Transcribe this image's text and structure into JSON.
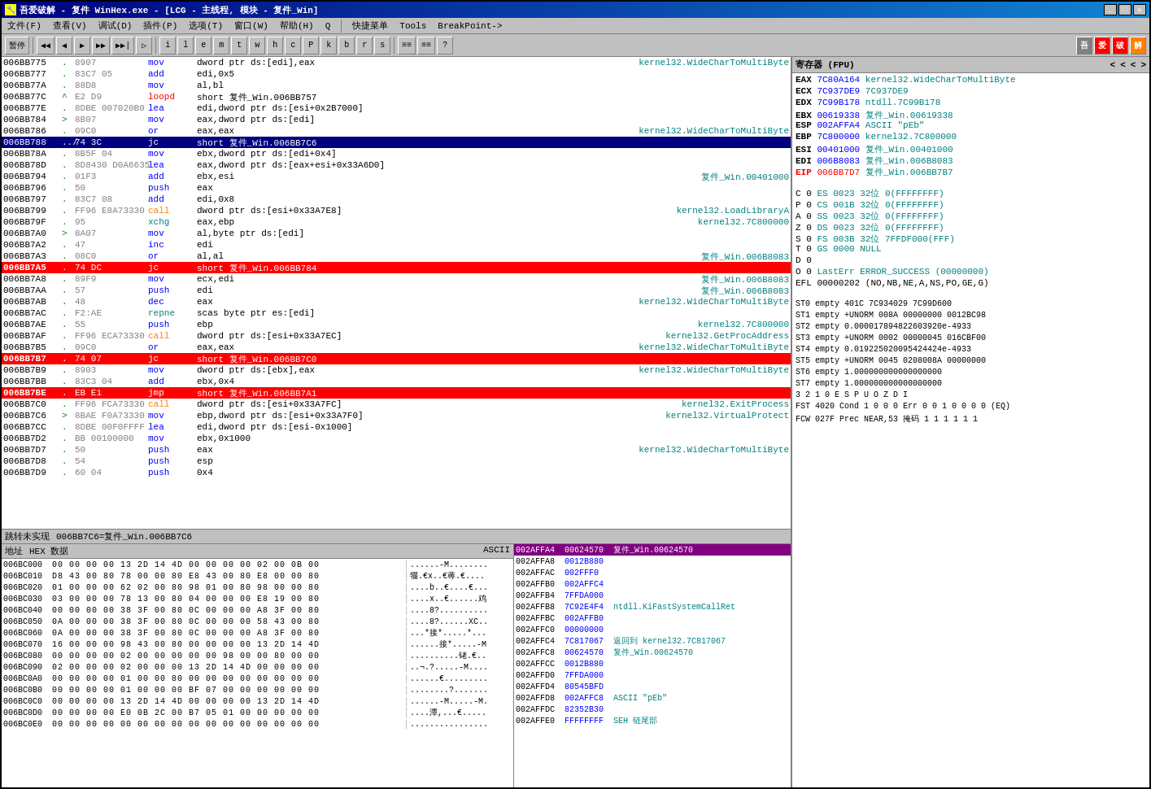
{
  "window": {
    "title": "吾爱破解 - 复件 WinHex.exe - [LCG - 主线程, 模块 - 复件_Win]",
    "titlebar_icon": "🔧"
  },
  "menu": {
    "items": [
      "文件(F)",
      "查看(V)",
      "调试(D)",
      "插件(P)",
      "选项(T)",
      "窗口(W)",
      "帮助(H)",
      "Q",
      "快捷菜单",
      "Tools",
      "BreakPoint->"
    ]
  },
  "toolbar": {
    "buttons": [
      "暂停",
      "◀◀",
      "◀",
      "▶▶",
      "▶▶|",
      "▶▶▶",
      "▷",
      "i",
      "l",
      "e",
      "m",
      "t",
      "w",
      "h",
      "c",
      "P",
      "k",
      "b",
      "r",
      "s",
      "≡≡",
      "≡≡",
      "?"
    ],
    "right_buttons": [
      "吾",
      "爱",
      "破",
      "解"
    ]
  },
  "disasm": {
    "rows": [
      {
        "addr": "006BB775",
        "arrow": ".",
        "bytes": "8907",
        "mnemonic": "mov",
        "operands": "dword ptr ds:[edi],eax",
        "comment": "kernel32.WideCharToMultiByte",
        "style": "normal"
      },
      {
        "addr": "006BB777",
        "arrow": ".",
        "bytes": "83C7 05",
        "mnemonic": "add",
        "operands": "edi,0x5",
        "comment": "",
        "style": "normal"
      },
      {
        "addr": "006BB77A",
        "arrow": ".",
        "bytes": "88D8",
        "mnemonic": "mov",
        "operands": "al,bl",
        "comment": "",
        "style": "normal"
      },
      {
        "addr": "006BB77C",
        "arrow": "^",
        "bytes": "E2 D9",
        "mnemonic": "loopd",
        "operands": "short 复件_Win.006BB757",
        "comment": "",
        "style": "normal"
      },
      {
        "addr": "006BB77E",
        "arrow": ".",
        "bytes": "8DBE 007020B0",
        "mnemonic": "lea",
        "operands": "edi,dword ptr ds:[esi+0x2B7000]",
        "comment": "",
        "style": "normal"
      },
      {
        "addr": "006BB784",
        "arrow": ">",
        "bytes": "8B07",
        "mnemonic": "mov",
        "operands": "eax,dword ptr ds:[edi]",
        "comment": "",
        "style": "normal"
      },
      {
        "addr": "006BB786",
        "arrow": ".",
        "bytes": "09C0",
        "mnemonic": "or",
        "operands": "eax,eax",
        "comment": "kernel32.WideCharToMultiByte",
        "style": "normal"
      },
      {
        "addr": "006BB788",
        "arrow": "../",
        "bytes": "74 3C",
        "mnemonic": "jc",
        "operands": "short 复件_Win.006BB7C6",
        "comment": "",
        "style": "selected"
      },
      {
        "addr": "006BB78A",
        "arrow": ".",
        "bytes": "8B5F 04",
        "mnemonic": "mov",
        "operands": "ebx,dword ptr ds:[edi+0x4]",
        "comment": "",
        "style": "normal"
      },
      {
        "addr": "006BB78D",
        "arrow": ".",
        "bytes": "8D8430 D0A6635",
        "mnemonic": "lea",
        "operands": "eax,dword ptr ds:[eax+esi+0x33A6D0]",
        "comment": "",
        "style": "normal"
      },
      {
        "addr": "006BB794",
        "arrow": ".",
        "bytes": "01F3",
        "mnemonic": "add",
        "operands": "ebx,esi",
        "comment": "复件_Win.00401000",
        "style": "normal"
      },
      {
        "addr": "006BB796",
        "arrow": ".",
        "bytes": "50",
        "mnemonic": "push",
        "operands": "eax",
        "comment": "",
        "style": "normal"
      },
      {
        "addr": "006BB797",
        "arrow": ".",
        "bytes": "83C7 08",
        "mnemonic": "add",
        "operands": "edi,0x8",
        "comment": "",
        "style": "normal"
      },
      {
        "addr": "006BB799",
        "arrow": ".",
        "bytes": "FF96 E8A73330",
        "mnemonic": "call",
        "operands": "dword ptr ds:[esi+0x33A7E8]",
        "comment": "kernel32.LoadLibraryA",
        "style": "normal"
      },
      {
        "addr": "006BB79F",
        "arrow": ".",
        "bytes": "95",
        "mnemonic": "xchg",
        "operands": "eax,ebp",
        "comment": "kernel32.7C800000",
        "style": "normal"
      },
      {
        "addr": "006BB7A0",
        "arrow": ">",
        "bytes": "8A07",
        "mnemonic": "mov",
        "operands": "al,byte ptr ds:[edi]",
        "comment": "",
        "style": "normal"
      },
      {
        "addr": "006BB7A2",
        "arrow": ".",
        "bytes": "47",
        "mnemonic": "inc",
        "operands": "edi",
        "comment": "",
        "style": "normal"
      },
      {
        "addr": "006BB7A3",
        "arrow": ".",
        "bytes": "08C0",
        "mnemonic": "or",
        "operands": "al,al",
        "comment": "复件_Win.006B8083",
        "style": "normal"
      },
      {
        "addr": "006BB7A5",
        "arrow": ".",
        "bytes": "74 DC",
        "mnemonic": "jc",
        "operands": "short 复件_Win.006BB784",
        "comment": "",
        "style": "red"
      },
      {
        "addr": "006BB7A8",
        "arrow": ".",
        "bytes": "89F9",
        "mnemonic": "mov",
        "operands": "ecx,edi",
        "comment": "复件_Win.006B8083",
        "style": "normal"
      },
      {
        "addr": "006BB7AA",
        "arrow": ".",
        "bytes": "57",
        "mnemonic": "push",
        "operands": "edi",
        "comment": "复件_Win.006B8083",
        "style": "normal"
      },
      {
        "addr": "006BB7AB",
        "arrow": ".",
        "bytes": "48",
        "mnemonic": "dec",
        "operands": "eax",
        "comment": "kernel32.WideCharToMultiByte",
        "style": "normal"
      },
      {
        "addr": "006BB7AC",
        "arrow": ".",
        "bytes": "F2:AE",
        "mnemonic": "repne",
        "operands": "scas byte ptr es:[edi]",
        "comment": "",
        "style": "normal"
      },
      {
        "addr": "006BB7AE",
        "arrow": ".",
        "bytes": "55",
        "mnemonic": "push",
        "operands": "ebp",
        "comment": "kernel32.7C800000",
        "style": "normal"
      },
      {
        "addr": "006BB7AF",
        "arrow": ".",
        "bytes": "FF96 ECA73330",
        "mnemonic": "call",
        "operands": "dword ptr ds:[esi+0x33A7EC]",
        "comment": "kernel32.GetProcAddress",
        "style": "normal"
      },
      {
        "addr": "006BB7B5",
        "arrow": ".",
        "bytes": "09C0",
        "mnemonic": "or",
        "operands": "eax,eax",
        "comment": "kernel32.WideCharToMultiByte",
        "style": "normal"
      },
      {
        "addr": "006BB7B7",
        "arrow": ".",
        "bytes": "74 07",
        "mnemonic": "jc",
        "operands": "short 复件_Win.006BB7C0",
        "comment": "",
        "style": "red"
      },
      {
        "addr": "006BB7B9",
        "arrow": ".",
        "bytes": "8903",
        "mnemonic": "mov",
        "operands": "dword ptr ds:[ebx],eax",
        "comment": "kernel32.WideCharToMultiByte",
        "style": "normal"
      },
      {
        "addr": "006BB7BB",
        "arrow": ".",
        "bytes": "83C3 04",
        "mnemonic": "add",
        "operands": "ebx,0x4",
        "comment": "",
        "style": "normal"
      },
      {
        "addr": "006BB7BE",
        "arrow": ".",
        "bytes": "EB E1",
        "mnemonic": "jmp",
        "operands": "short 复件_Win.006BB7A1",
        "comment": "",
        "style": "red"
      },
      {
        "addr": "006BB7C0",
        "arrow": ".",
        "bytes": "FF96 FCA73330",
        "mnemonic": "call",
        "operands": "dword ptr ds:[esi+0x33A7FC]",
        "comment": "kernel32.ExitProcess",
        "style": "normal"
      },
      {
        "addr": "006BB7C6",
        "arrow": ">",
        "bytes": "8BAE F0A73330",
        "mnemonic": "mov",
        "operands": "ebp,dword ptr ds:[esi+0x33A7F0]",
        "comment": "kernel32.VirtualProtect",
        "style": "normal"
      },
      {
        "addr": "006BB7CC",
        "arrow": ".",
        "bytes": "8DBE 00F0FFFF",
        "mnemonic": "lea",
        "operands": "edi,dword ptr ds:[esi-0x1000]",
        "comment": "",
        "style": "normal"
      },
      {
        "addr": "006BB7D2",
        "arrow": ".",
        "bytes": "BB 00100000",
        "mnemonic": "mov",
        "operands": "ebx,0x1000",
        "comment": "",
        "style": "normal"
      },
      {
        "addr": "006BB7D7",
        "arrow": ".",
        "bytes": "50",
        "mnemonic": "push",
        "operands": "eax",
        "comment": "kernel32.WideCharToMultiByte",
        "style": "normal"
      },
      {
        "addr": "006BB7D8",
        "arrow": ".",
        "bytes": "54",
        "mnemonic": "push",
        "operands": "esp",
        "comment": "",
        "style": "normal"
      },
      {
        "addr": "006BB7D9",
        "arrow": ".",
        "bytes": "60 04",
        "mnemonic": "push",
        "operands": "0x4",
        "comment": "",
        "style": "normal"
      }
    ]
  },
  "status": {
    "text1": "跳转未实现",
    "text2": "006BB7C6=复件_Win.006BB7C6"
  },
  "registers": {
    "title": "寄存器 (FPU)",
    "rows": [
      {
        "name": "EAX",
        "val": "7C80A164",
        "comment": "kernel32.WideCharToMultiByte"
      },
      {
        "name": "ECX",
        "val": "7C937DE9",
        "comment": "7C937DE9"
      },
      {
        "name": "EDX",
        "val": "7C99B178",
        "comment": "ntdll.7C99B178"
      },
      {
        "name": "EBX",
        "val": "00619338",
        "comment": "复件_Win.00619338"
      },
      {
        "name": "ESP",
        "val": "002AFFA4",
        "comment": "ASCII \"pEb\""
      },
      {
        "name": "EBP",
        "val": "7C800000",
        "comment": "kernel32.7C800000"
      },
      {
        "name": "ESI",
        "val": "00401000",
        "comment": "复件_Win.00401000"
      },
      {
        "name": "EDI",
        "val": "006B8083",
        "comment": "复件_Win.006B8083"
      },
      {
        "name": "EIP",
        "val": "006BB7D7",
        "comment": "复件_Win.006BB7B7",
        "style": "eip"
      }
    ],
    "flags": [
      {
        "name": "C 0",
        "comment": "ES 0023  32位  0(FFFFFFFF)"
      },
      {
        "name": "P 0",
        "comment": "CS 001B  32位  0(FFFFFFFF)"
      },
      {
        "name": "A 0",
        "comment": "SS 0023  32位  0(FFFFFFFF)"
      },
      {
        "name": "Z 0",
        "comment": "DS 0023  32位  0(FFFFFFFF)"
      },
      {
        "name": "S 0",
        "comment": "FS 003B  32位  7FFDF000(FFF)"
      },
      {
        "name": "T 0",
        "comment": "GS 0000  NULL"
      },
      {
        "name": "D 0",
        "comment": ""
      },
      {
        "name": "O 0",
        "comment": "LastErr ERROR_SUCCESS (00000000)"
      }
    ],
    "efl": "EFL 00000202 (NO,NB,NE,A,NS,PO,GE,G)",
    "fpu_rows": [
      "ST0 empty  401C  7C934029  7C99D600",
      "ST1 empty +UNORM 008A  00000000  0012BC98",
      "ST2 empty  0.000017894822603920e-4933",
      "ST3 empty +UNORM 0002  00000045  016CBF00",
      "ST4 empty  0.019225020095424424e-4933",
      "ST5 empty +UNORM 0045  0208008A  00000000",
      "ST6 empty  1.000000000000000000",
      "ST7 empty  1.000000000000000000",
      "       3 2 1 0      E S P U O Z D I",
      "FST 4020  Cond 1 0 0 0  Err 0 0 1 0 0 0 0  (EQ)",
      "FCW 027F  Prec NEAR,53  掩码   1 1 1 1 1 1"
    ]
  },
  "hex": {
    "headers": [
      "地址",
      "HEX 数据",
      "ASCII"
    ],
    "rows": [
      {
        "addr": "006BC000",
        "hex": "00 00 00 00 13 2D 14 4D 00 00 00 00 02 00 0B 00",
        "ascii": "......-M........"
      },
      {
        "addr": "006BC010",
        "hex": "D8 43 00 80 78 00 00 80 E8 43 00 80 E8 00 00 80",
        "ascii": "犤.€x..€蒪.€...."
      },
      {
        "addr": "006BC020",
        "hex": "01 00 00 00 62 02 00 80 98 01 00 80 98 00 00 80",
        "ascii": "....b..€....€..."
      },
      {
        "addr": "006BC030",
        "hex": "03 00 00 00 78 13 00 80 04 00 00 00 E8 19 00 80",
        "ascii": "....x..€......鸡"
      },
      {
        "addr": "006BC040",
        "hex": "00 00 00 00 38 3F 00 80 0C 00 00 00 A8 3F 00 80",
        "ascii": "....8?.........."
      },
      {
        "addr": "006BC050",
        "hex": "0A 00 00 00 38 3F 00 80 0C 00 00 00 58 43 00 80",
        "ascii": "....8?......XC.."
      },
      {
        "addr": "006BC060",
        "hex": "0A 00 00 00 38 3F 00 80 0C 00 00 00 A8 3F 00 80",
        "ascii": "...*接*.....*..."
      },
      {
        "addr": "006BC070",
        "hex": "16 00 00 00 98 43 00 80 00 00 00 00 13 2D 14 4D",
        "ascii": "......接*.....-M"
      },
      {
        "addr": "006BC080",
        "hex": "00 00 00 00 02 00 00 00 00 00 98 00 00 80 00 00",
        "ascii": "..........铑.€.."
      },
      {
        "addr": "006BC090",
        "hex": "02 00 00 00 02 00 00 00 13 2D 14 4D 00 00 00 00",
        "ascii": "..¬.?.....-M...."
      },
      {
        "addr": "006BC0A0",
        "hex": "00 00 00 00 01 00 00 80 00 00 00 00 00 00 00 00",
        "ascii": "......€........."
      },
      {
        "addr": "006BC0B0",
        "hex": "00 00 00 00 01 00 00 00 BF 07 00 00 00 00 00 00",
        "ascii": "........?......."
      },
      {
        "addr": "006BC0C0",
        "hex": "00 00 00 00 13 2D 14 4D 00 00 00 00 13 2D 14 4D",
        "ascii": "......-M.....-M."
      },
      {
        "addr": "006BC0D0",
        "hex": "00 00 00 00 E0 0B 2C 00 B7 05 01 00 00 00 00 00",
        "ascii": "....潭,...€....."
      },
      {
        "addr": "006BC0E0",
        "hex": "00 00 00 00 00 00 00 00 00 00 00 00 00 00 00 00",
        "ascii": "................"
      }
    ]
  },
  "stack": {
    "rows": [
      {
        "addr": "002AFFA4",
        "val": "00624570",
        "comment": "复件_Win.00624570",
        "style": "highlighted"
      },
      {
        "addr": "002AFFA8",
        "val": "0012B880",
        "comment": ""
      },
      {
        "addr": "002AFFAC",
        "val": "002FFF0",
        "comment": ""
      },
      {
        "addr": "002AFFB0",
        "val": "002AFFC4",
        "comment": ""
      },
      {
        "addr": "002AFFB4",
        "val": "7FFDA000",
        "comment": ""
      },
      {
        "addr": "002AFFB8",
        "val": "7C92E4F4",
        "comment": "ntdll.KiFastSystemCallRet"
      },
      {
        "addr": "002AFFBC",
        "val": "002AFFB0",
        "comment": ""
      },
      {
        "addr": "002AFFC0",
        "val": "00000000",
        "comment": ""
      },
      {
        "addr": "002AFFC4",
        "val": "7C817067",
        "comment": "返回到 kernel32.7C817067"
      },
      {
        "addr": "002AFFC8",
        "val": "00624570",
        "comment": "复件_Win.00624570"
      },
      {
        "addr": "002AFFCC",
        "val": "0012B880",
        "comment": ""
      },
      {
        "addr": "002AFFD0",
        "val": "7FFDA000",
        "comment": ""
      },
      {
        "addr": "002AFFD4",
        "val": "80545BFD",
        "comment": ""
      },
      {
        "addr": "002AFFD8",
        "val": "002AFFC8",
        "comment": "ASCII \"pEb\""
      },
      {
        "addr": "002AFFDC",
        "val": "82352B30",
        "comment": ""
      },
      {
        "addr": "002AFFE0",
        "val": "FFFFFFFF",
        "comment": "SEH 链尾部"
      }
    ]
  }
}
